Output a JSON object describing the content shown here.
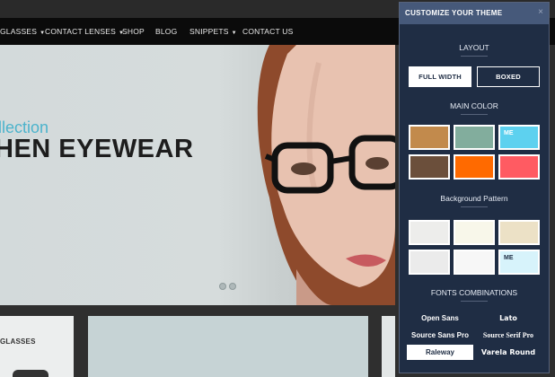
{
  "nav": {
    "items": [
      {
        "label": "GLASSES",
        "dropdown": true
      },
      {
        "label": "CONTACT LENSES",
        "dropdown": true
      },
      {
        "label": "SHOP",
        "dropdown": false
      },
      {
        "label": "BLOG",
        "dropdown": false
      },
      {
        "label": "SNIPPETS",
        "dropdown": true
      },
      {
        "label": "CONTACT US",
        "dropdown": false
      }
    ]
  },
  "hero": {
    "line1": "llection",
    "line2": "HEN EYEWEAR"
  },
  "lower": {
    "card_left_title": "GLASSES"
  },
  "panel": {
    "title": "CUSTOMIZE YOUR THEME",
    "close_glyph": "×",
    "layout": {
      "title": "LAYOUT",
      "options": [
        "FULL WIDTH",
        "BOXED"
      ],
      "selected": "FULL WIDTH"
    },
    "main_color": {
      "title": "MAIN COLOR",
      "swatches": [
        {
          "color": "#c28a4c",
          "label": ""
        },
        {
          "color": "#82ad9d",
          "label": ""
        },
        {
          "color": "#5dd1ef",
          "label": "ME"
        },
        {
          "color": "#6b4f3b",
          "label": ""
        },
        {
          "color": "#ff6a00",
          "label": ""
        },
        {
          "color": "#ff5b62",
          "label": ""
        }
      ]
    },
    "background_pattern": {
      "title": "Background Pattern",
      "patterns": [
        {
          "color": "#ededeb",
          "label": ""
        },
        {
          "color": "#f8f7ea",
          "label": ""
        },
        {
          "color": "#ece1c6",
          "label": ""
        },
        {
          "color": "#ebebeb",
          "label": ""
        },
        {
          "color": "#f7f7f7",
          "label": ""
        },
        {
          "color": "#d7f3fb",
          "label": "ME"
        }
      ]
    },
    "fonts": {
      "title": "FONTS COMBINATIONS",
      "options": [
        "Open Sans",
        "Lato",
        "Source Sans Pro",
        "Source Serif Pro",
        "Raleway",
        "Varela Round"
      ],
      "selected": "Raleway"
    }
  },
  "colors": {
    "panel_bg": "#1f2d44",
    "panel_header": "#46597a",
    "accent": "#4cb3cc"
  }
}
